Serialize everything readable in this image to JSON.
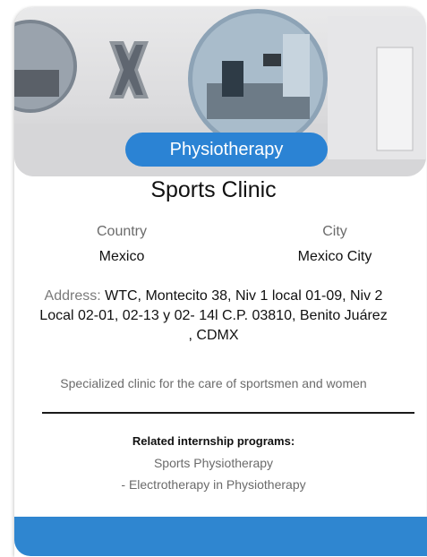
{
  "card": {
    "category_badge": "Physiotherapy",
    "title": "Sports Clinic",
    "country_label": "Country",
    "country_value": "Mexico",
    "city_label": "City",
    "city_value": "Mexico City",
    "address_label": "Address:",
    "address_value": " WTC, Montecito 38, Niv 1 local 01-09, Niv 2 Local 02-01, 02-13 y 02- 14l C.P. 03810, Benito Juárez , CDMX",
    "description": "Specialized clinic for the care of sportsmen and women",
    "related_heading": "Related internship programs:",
    "programs": [
      "Sports Physiotherapy",
      "- Electrotherapy in Physiotherapy"
    ]
  },
  "colors": {
    "accent": "#2b83d4",
    "footer": "#2f86d0"
  }
}
